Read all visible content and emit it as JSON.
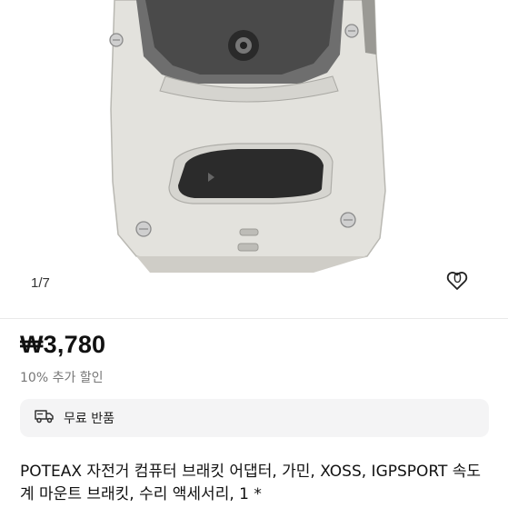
{
  "gallery": {
    "pager": "1/7",
    "favorite_count": "0",
    "image_subject": "bike-computer-mount-photo"
  },
  "price": {
    "amount": "₩3,780",
    "discount": "10% 추가 할인"
  },
  "shipping": {
    "return_label": "무료 반품",
    "icon": "truck-icon"
  },
  "product": {
    "title": "POTEAX 자전거 컴퓨터 브래킷 어댑터, 가민, XOSS, IGPSPORT 속도계 마운트 브래킷, 수리 액세서리, 1 *"
  }
}
